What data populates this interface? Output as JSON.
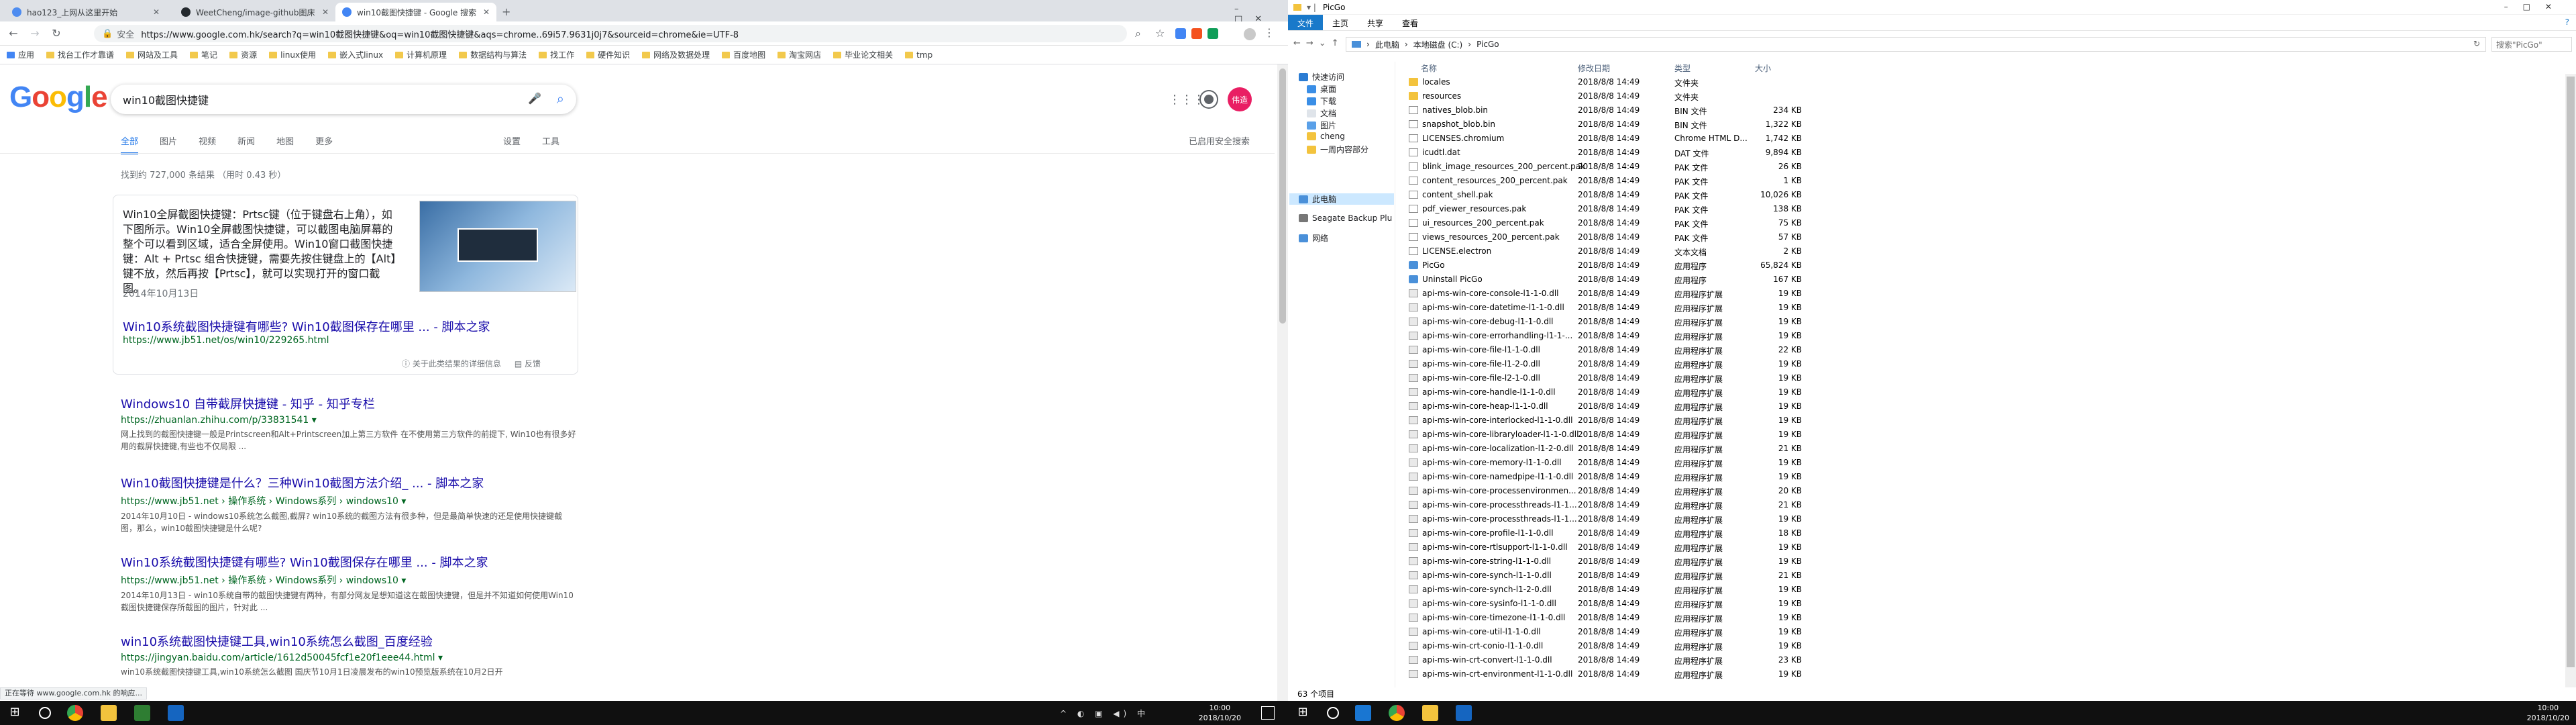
{
  "browser": {
    "tabs": [
      {
        "label": "hao123_上网从这里开始",
        "favicon_color": "#4e8cf0"
      },
      {
        "label": "WeetCheng/image-github图床",
        "favicon_color": "#24292e"
      },
      {
        "label": "win10截图快捷键 - Google 搜索",
        "favicon_color": "#4285f4"
      }
    ],
    "new_tab_icon": "plus-icon",
    "security": "安全",
    "url": "https://www.google.com.hk/search?q=win10截图快捷键&oq=win10截图快捷键&aqs=chrome..69i57.9631j0j7&sourceid=chrome&ie=UTF-8",
    "bookmarks": [
      "应用",
      "找台工作才靠谱",
      "网站及工具",
      "笔记",
      "资源",
      "linux使用",
      "嵌入式linux",
      "计算机原理",
      "数据结构与算法",
      "找工作",
      "硬件知识",
      "网络及数据处理",
      "百度地图",
      "淘宝网店",
      "毕业论文相关",
      "tmp"
    ],
    "status_text": "正在等待 www.google.com.hk 的响应..."
  },
  "google": {
    "logo": "Google",
    "query": "win10截图快捷键",
    "avatar_text": "伟造",
    "tabs": [
      "全部",
      "图片",
      "视频",
      "新闻",
      "地图",
      "更多"
    ],
    "tools": [
      "设置",
      "工具"
    ],
    "safe_search": "已启用安全搜索",
    "stats": "找到约 727,000 条结果 （用时 0.43 秒）",
    "snippet": {
      "text": "Win10全屏截图快捷键：Prtsc键（位于键盘右上角），如下图所示。Win10全屏截图快捷键，可以截图电脑屏幕的整个可以看到区域，适合全屏使用。Win10窗口截图快捷键：Alt + Prtsc 组合快捷键，需要先按住键盘上的【Alt】键不放，然后再按【Prtsc】，就可以实现打开的窗口截图。",
      "date": "2014年10月13日",
      "link": "Win10系统截图快捷键有哪些? Win10截图保存在哪里 ... - 脚本之家",
      "url": "https://www.jb51.net/os/win10/229265.html",
      "about": "关于此类结果的详细信息",
      "feedback": "反馈"
    },
    "results": [
      {
        "title": "Windows10 自带截屏快捷键 - 知乎 - 知乎专栏",
        "url": "https://zhuanlan.zhihu.com/p/33831541 ▾",
        "desc": "网上找到的截图快捷键一般是Printscreen和Alt+Printscreen加上第三方软件 在不使用第三方软件的前提下, Win10也有很多好用的截屏快捷键,有些也不仅局限 ..."
      },
      {
        "title": "Win10截图快捷键是什么？三种Win10截图方法介绍_ ... - 脚本之家",
        "url": "https://www.jb51.net › 操作系统 › Windows系列 › windows10 ▾",
        "desc": "2014年10月10日 - windows10系统怎么截图,截屏? win10系统的截图方法有很多种，但是最简单快速的还是使用快捷键截图，那么，win10截图快捷键是什么呢?"
      },
      {
        "title": "Win10系统截图快捷键有哪些? Win10截图保存在哪里 ... - 脚本之家",
        "url": "https://www.jb51.net › 操作系统 › Windows系列 › windows10 ▾",
        "desc": "2014年10月13日 - win10系统自带的截图快捷键有两种，有部分网友是想知道这在截图快捷键，但是并不知道如何使用Win10截图快捷键保存所截图的图片，针对此 ..."
      },
      {
        "title": "win10系统截图快捷键工具,win10系统怎么截图_百度经验",
        "url": "https://jingyan.baidu.com/article/1612d50045fcf1e20f1eee44.html ▾",
        "desc": "win10系统截图快捷键工具,win10系统怎么截图 国庆节10月1日凌晨发布的win10预览版系统在10月2日开"
      }
    ]
  },
  "explorer": {
    "title": "PicGo",
    "ribbon_tabs": [
      "文件",
      "主页",
      "共享",
      "查看"
    ],
    "path": [
      "此电脑",
      "本地磁盘 (C:)",
      "PicGo"
    ],
    "search_placeholder": "搜索\"PicGo\"",
    "nav": [
      {
        "label": "快速访问",
        "color": "#2b7cd3"
      },
      {
        "label": "桌面",
        "color": "#3a8ee6"
      },
      {
        "label": "下载",
        "color": "#3a8ee6"
      },
      {
        "label": "文档",
        "color": "#dfe4ea"
      },
      {
        "label": "图片",
        "color": "#5aa0e8"
      },
      {
        "label": "cheng",
        "color": "#f3c33d"
      },
      {
        "label": "一周内容部分",
        "color": "#f3c33d"
      },
      {
        "label": "此电脑",
        "color": "#4a90d9"
      },
      {
        "label": "Seagate Backup Plu",
        "color": "#777777"
      },
      {
        "label": "网络",
        "color": "#4a90d9"
      }
    ],
    "columns": [
      "名称",
      "修改日期",
      "类型",
      "大小"
    ],
    "files": [
      [
        "locales",
        "2018/8/8 14:49",
        "文件夹",
        "",
        "folder"
      ],
      [
        "resources",
        "2018/8/8 14:49",
        "文件夹",
        "",
        "folder"
      ],
      [
        "natives_blob.bin",
        "2018/8/8 14:49",
        "BIN 文件",
        "234 KB",
        "doc"
      ],
      [
        "snapshot_blob.bin",
        "2018/8/8 14:49",
        "BIN 文件",
        "1,322 KB",
        "doc"
      ],
      [
        "LICENSES.chromium",
        "2018/8/8 14:49",
        "Chrome HTML D...",
        "1,742 KB",
        "doc"
      ],
      [
        "icudtl.dat",
        "2018/8/8 14:49",
        "DAT 文件",
        "9,894 KB",
        "doc"
      ],
      [
        "blink_image_resources_200_percent.pak",
        "2018/8/8 14:49",
        "PAK 文件",
        "26 KB",
        "doc"
      ],
      [
        "content_resources_200_percent.pak",
        "2018/8/8 14:49",
        "PAK 文件",
        "1 KB",
        "doc"
      ],
      [
        "content_shell.pak",
        "2018/8/8 14:49",
        "PAK 文件",
        "10,026 KB",
        "doc"
      ],
      [
        "pdf_viewer_resources.pak",
        "2018/8/8 14:49",
        "PAK 文件",
        "138 KB",
        "doc"
      ],
      [
        "ui_resources_200_percent.pak",
        "2018/8/8 14:49",
        "PAK 文件",
        "75 KB",
        "doc"
      ],
      [
        "views_resources_200_percent.pak",
        "2018/8/8 14:49",
        "PAK 文件",
        "57 KB",
        "doc"
      ],
      [
        "LICENSE.electron",
        "2018/8/8 14:49",
        "文本文档",
        "2 KB",
        "doc"
      ],
      [
        "PicGo",
        "2018/8/8 14:49",
        "应用程序",
        "65,824 KB",
        "exe"
      ],
      [
        "Uninstall PicGo",
        "2018/8/8 14:49",
        "应用程序",
        "167 KB",
        "exe"
      ],
      [
        "api-ms-win-core-console-l1-1-0.dll",
        "2018/8/8 14:49",
        "应用程序扩展",
        "19 KB",
        "dll"
      ],
      [
        "api-ms-win-core-datetime-l1-1-0.dll",
        "2018/8/8 14:49",
        "应用程序扩展",
        "19 KB",
        "dll"
      ],
      [
        "api-ms-win-core-debug-l1-1-0.dll",
        "2018/8/8 14:49",
        "应用程序扩展",
        "19 KB",
        "dll"
      ],
      [
        "api-ms-win-core-errorhandling-l1-1-...",
        "2018/8/8 14:49",
        "应用程序扩展",
        "19 KB",
        "dll"
      ],
      [
        "api-ms-win-core-file-l1-1-0.dll",
        "2018/8/8 14:49",
        "应用程序扩展",
        "22 KB",
        "dll"
      ],
      [
        "api-ms-win-core-file-l1-2-0.dll",
        "2018/8/8 14:49",
        "应用程序扩展",
        "19 KB",
        "dll"
      ],
      [
        "api-ms-win-core-file-l2-1-0.dll",
        "2018/8/8 14:49",
        "应用程序扩展",
        "19 KB",
        "dll"
      ],
      [
        "api-ms-win-core-handle-l1-1-0.dll",
        "2018/8/8 14:49",
        "应用程序扩展",
        "19 KB",
        "dll"
      ],
      [
        "api-ms-win-core-heap-l1-1-0.dll",
        "2018/8/8 14:49",
        "应用程序扩展",
        "19 KB",
        "dll"
      ],
      [
        "api-ms-win-core-interlocked-l1-1-0.dll",
        "2018/8/8 14:49",
        "应用程序扩展",
        "19 KB",
        "dll"
      ],
      [
        "api-ms-win-core-libraryloader-l1-1-0.dll",
        "2018/8/8 14:49",
        "应用程序扩展",
        "19 KB",
        "dll"
      ],
      [
        "api-ms-win-core-localization-l1-2-0.dll",
        "2018/8/8 14:49",
        "应用程序扩展",
        "21 KB",
        "dll"
      ],
      [
        "api-ms-win-core-memory-l1-1-0.dll",
        "2018/8/8 14:49",
        "应用程序扩展",
        "19 KB",
        "dll"
      ],
      [
        "api-ms-win-core-namedpipe-l1-1-0.dll",
        "2018/8/8 14:49",
        "应用程序扩展",
        "19 KB",
        "dll"
      ],
      [
        "api-ms-win-core-processenvironmen...",
        "2018/8/8 14:49",
        "应用程序扩展",
        "20 KB",
        "dll"
      ],
      [
        "api-ms-win-core-processthreads-l1-1...",
        "2018/8/8 14:49",
        "应用程序扩展",
        "21 KB",
        "dll"
      ],
      [
        "api-ms-win-core-processthreads-l1-1...",
        "2018/8/8 14:49",
        "应用程序扩展",
        "19 KB",
        "dll"
      ],
      [
        "api-ms-win-core-profile-l1-1-0.dll",
        "2018/8/8 14:49",
        "应用程序扩展",
        "18 KB",
        "dll"
      ],
      [
        "api-ms-win-core-rtlsupport-l1-1-0.dll",
        "2018/8/8 14:49",
        "应用程序扩展",
        "19 KB",
        "dll"
      ],
      [
        "api-ms-win-core-string-l1-1-0.dll",
        "2018/8/8 14:49",
        "应用程序扩展",
        "19 KB",
        "dll"
      ],
      [
        "api-ms-win-core-synch-l1-1-0.dll",
        "2018/8/8 14:49",
        "应用程序扩展",
        "21 KB",
        "dll"
      ],
      [
        "api-ms-win-core-synch-l1-2-0.dll",
        "2018/8/8 14:49",
        "应用程序扩展",
        "19 KB",
        "dll"
      ],
      [
        "api-ms-win-core-sysinfo-l1-1-0.dll",
        "2018/8/8 14:49",
        "应用程序扩展",
        "19 KB",
        "dll"
      ],
      [
        "api-ms-win-core-timezone-l1-1-0.dll",
        "2018/8/8 14:49",
        "应用程序扩展",
        "19 KB",
        "dll"
      ],
      [
        "api-ms-win-core-util-l1-1-0.dll",
        "2018/8/8 14:49",
        "应用程序扩展",
        "19 KB",
        "dll"
      ],
      [
        "api-ms-win-crt-conio-l1-1-0.dll",
        "2018/8/8 14:49",
        "应用程序扩展",
        "19 KB",
        "dll"
      ],
      [
        "api-ms-win-crt-convert-l1-1-0.dll",
        "2018/8/8 14:49",
        "应用程序扩展",
        "23 KB",
        "dll"
      ],
      [
        "api-ms-win-crt-environment-l1-1-0.dll",
        "2018/8/8 14:49",
        "应用程序扩展",
        "19 KB",
        "dll"
      ]
    ],
    "status": "63 个项目"
  },
  "taskbar": {
    "left_clock": {
      "time": "10:00",
      "date": "2018/10/20"
    },
    "right_clock": {
      "time": "10:00",
      "date": "2018/10/20"
    }
  }
}
